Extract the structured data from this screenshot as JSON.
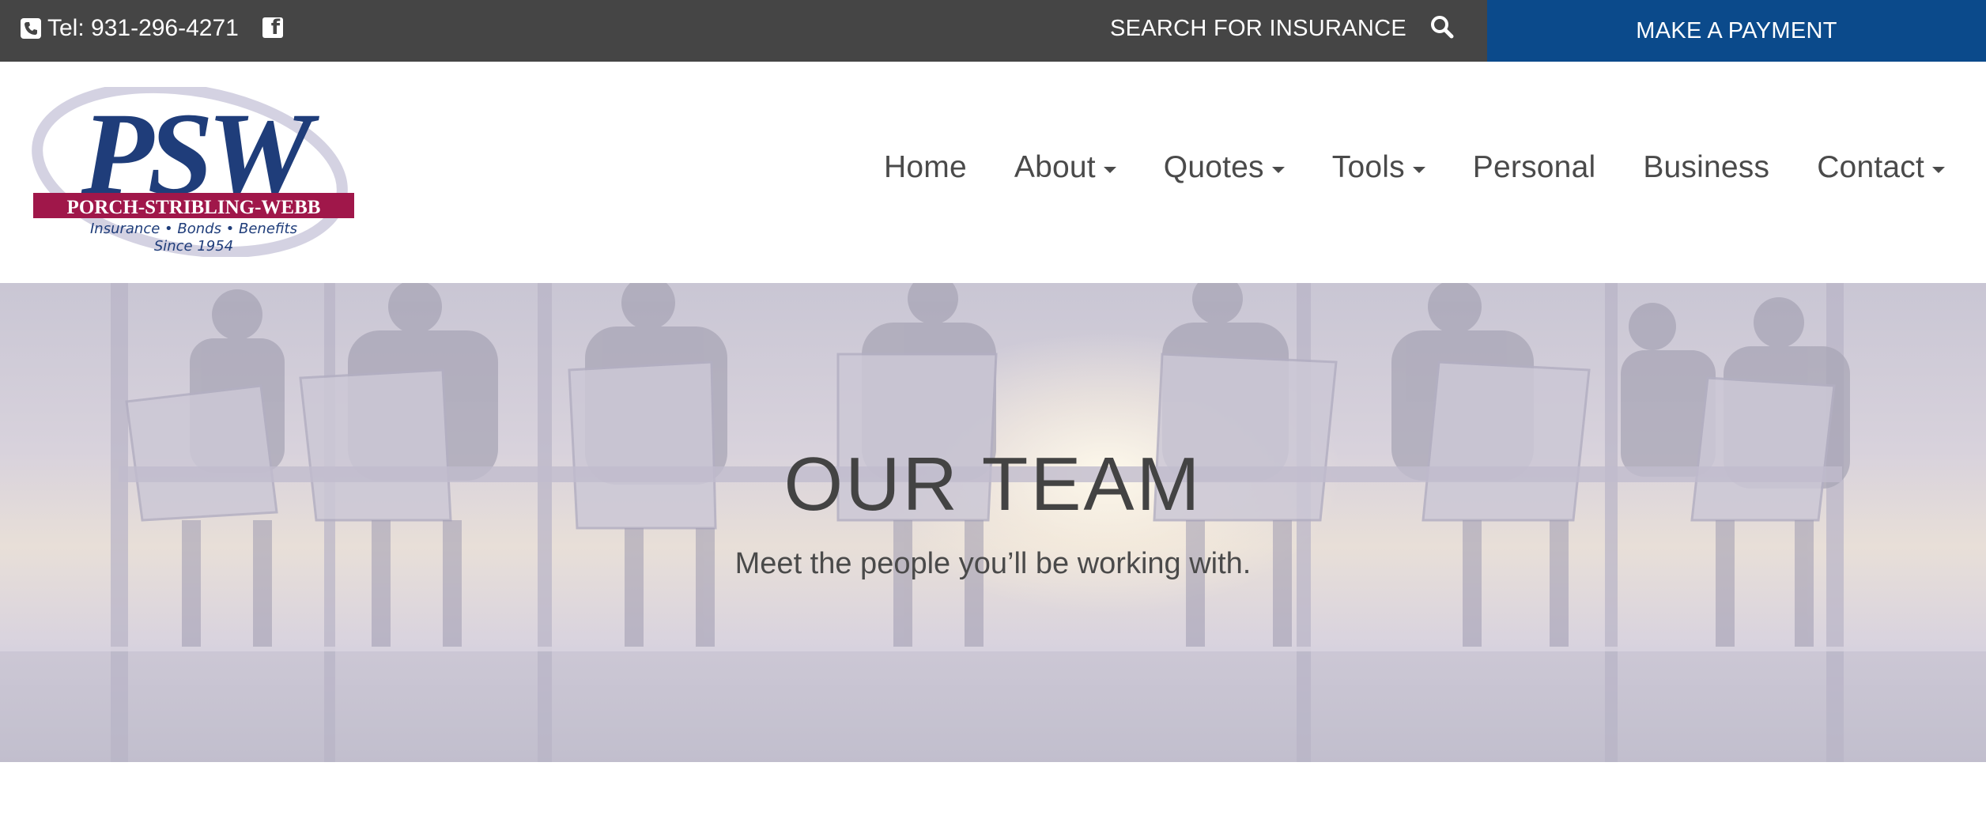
{
  "topbar": {
    "phone": "Tel: 931-296-4271",
    "phone_icon": "phone-icon",
    "social_icon": "facebook-icon",
    "search_label": "SEARCH FOR INSURANCE",
    "search_icon": "search-icon",
    "payment_label": "MAKE A PAYMENT"
  },
  "logo": {
    "letters": "PSW",
    "name": "PORCH-STRIBLING-WEBB",
    "tagline": "Insurance • Bonds • Benefits",
    "since": "Since 1954"
  },
  "nav": {
    "items": [
      {
        "label": "Home"
      },
      {
        "label": "About"
      },
      {
        "label": "Quotes"
      },
      {
        "label": "Tools"
      },
      {
        "label": "Personal"
      },
      {
        "label": "Business"
      },
      {
        "label": "Contact"
      }
    ]
  },
  "hero": {
    "title": "OUR TEAM",
    "subtitle": "Meet the people you’ll be working with."
  },
  "colors": {
    "topbar": "#454545",
    "payment": "#0b4a8b",
    "logo_blue": "#1f3d7a",
    "logo_red": "#a0174a"
  }
}
